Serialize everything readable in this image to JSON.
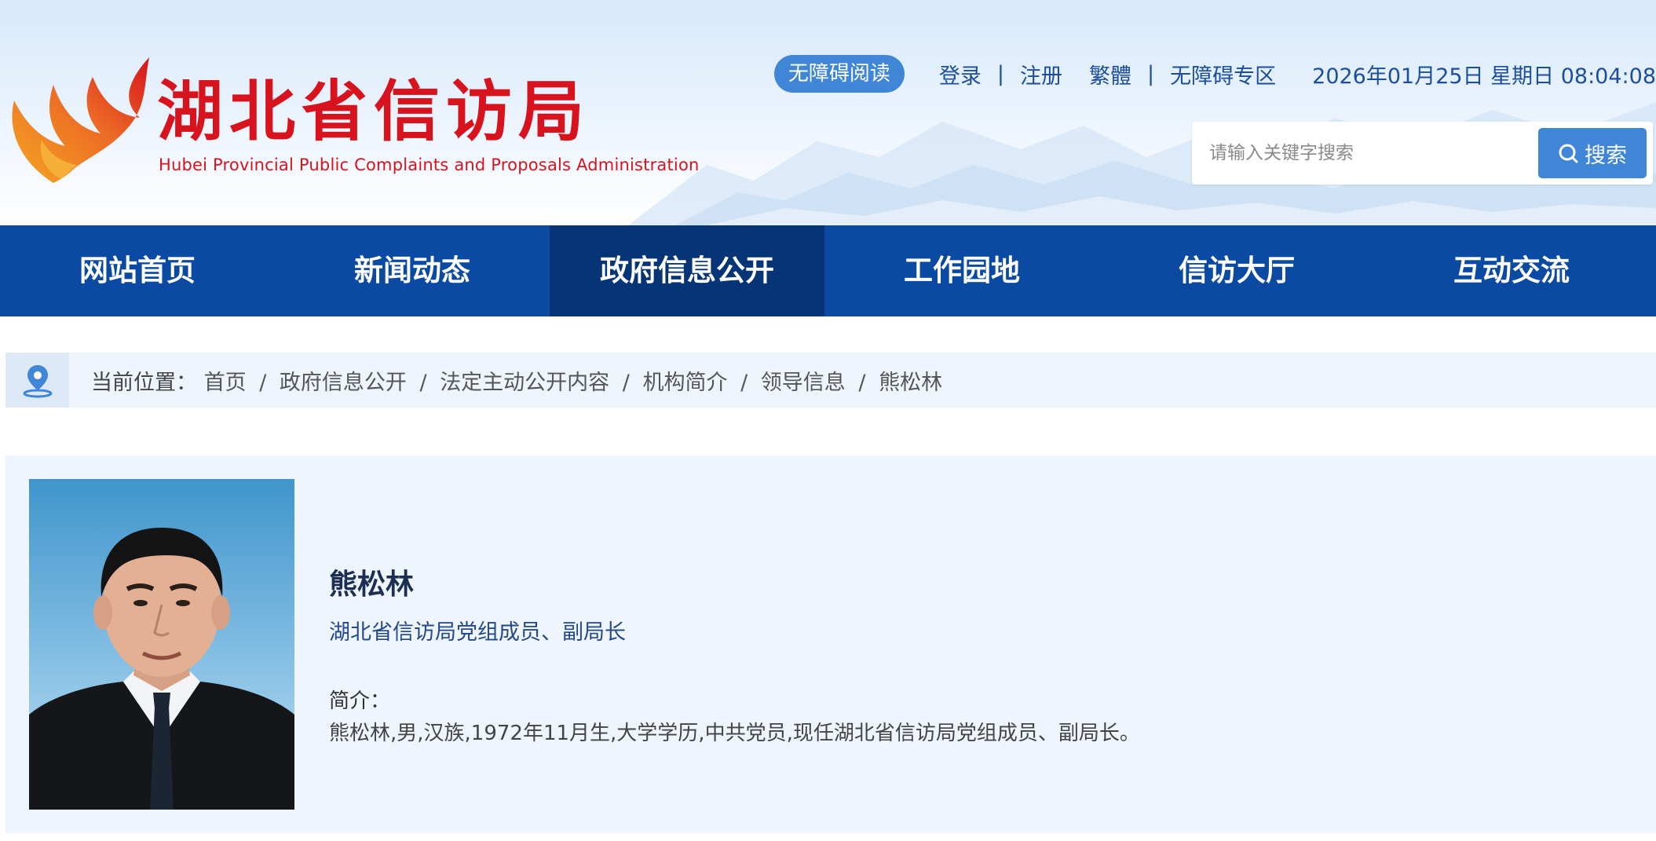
{
  "header": {
    "site_title": "湖北省信访局",
    "site_subtitle": "Hubei Provincial Public Complaints and Proposals Administration",
    "accessibility_reading": "无障碍阅读",
    "login": "登录",
    "separator": "|",
    "register": "注册",
    "traditional": "繁體",
    "accessibility_zone": "无障碍专区",
    "datetime": "2026年01月25日 星期日 08:04:08",
    "search": {
      "placeholder": "请输入关键字搜索",
      "button_label": "搜索",
      "button_icon": "search-icon"
    }
  },
  "nav": {
    "items": [
      {
        "label": "网站首页"
      },
      {
        "label": "新闻动态"
      },
      {
        "label": "政府信息公开",
        "active": true
      },
      {
        "label": "工作园地"
      },
      {
        "label": "信访大厅"
      },
      {
        "label": "互动交流"
      }
    ]
  },
  "breadcrumb": {
    "icon": "location-pin-icon",
    "prefix": "当前位置：",
    "separator": "/",
    "items": [
      "首页",
      "政府信息公开",
      "法定主动公开内容",
      "机构简介",
      "领导信息"
    ],
    "current": "熊松林"
  },
  "profile": {
    "name": "熊松林",
    "position": "湖北省信访局党组成员、副局长",
    "intro_label": "简介：",
    "bio": "熊松林,男,汉族,1972年11月生,大学学历,中共党员,现任湖北省信访局党组成员、副局长。"
  },
  "colors": {
    "brand_red": "#d7131d",
    "nav_blue": "#0b4aa2",
    "nav_active": "#063577",
    "accent_blue": "#3f86d6",
    "panel_bg": "#eef5fd"
  }
}
